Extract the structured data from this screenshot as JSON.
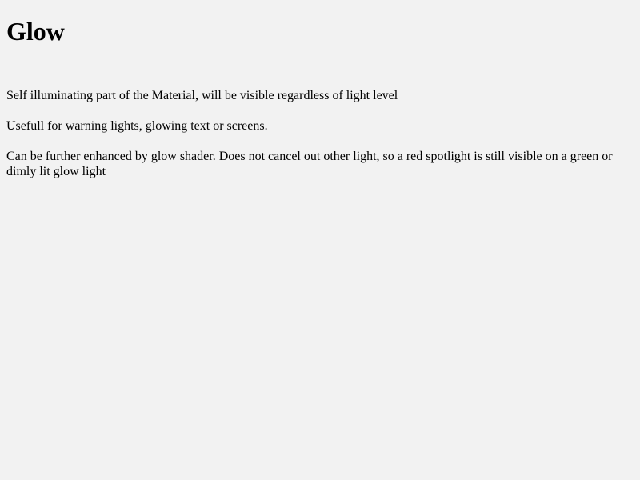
{
  "page": {
    "title": "Glow",
    "paragraphs": [
      "Self illuminating part of the Material, will be visible regardless of light level",
      "Usefull for warning lights, glowing text or screens.",
      "Can be further enhanced by glow shader. Does not cancel out other light, so a red spotlight is still visible on a green or dimly lit glow light"
    ]
  },
  "colors": {
    "background": "#f2f2f2",
    "text": "#000000"
  }
}
